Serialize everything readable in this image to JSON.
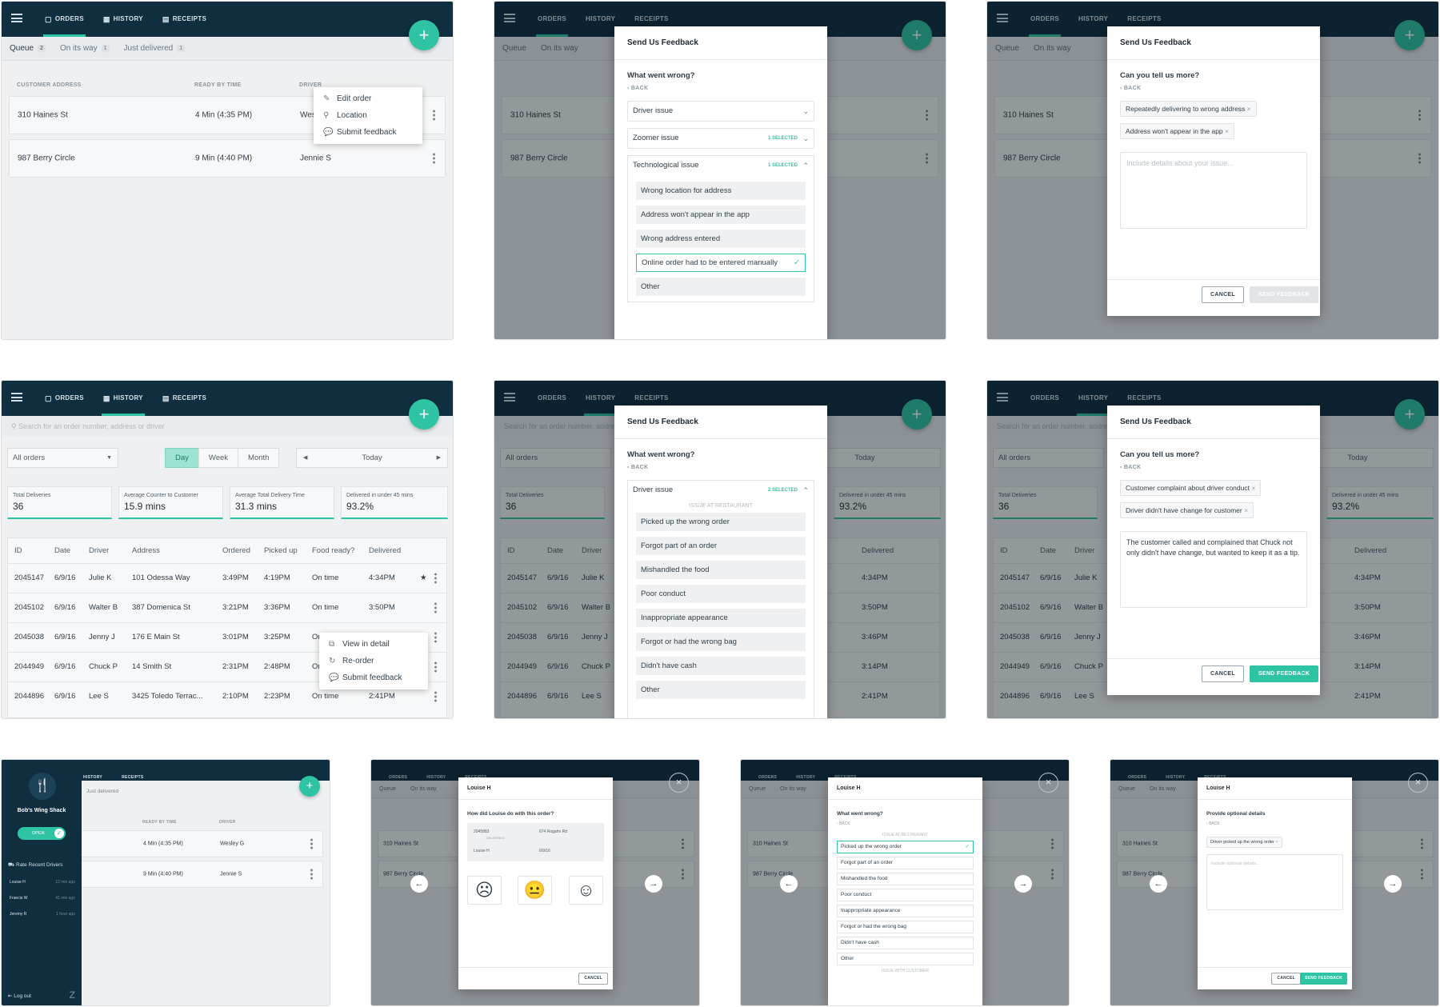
{
  "tabs": {
    "orders": "ORDERS",
    "history": "HISTORY",
    "receipts": "RECEIPTS"
  },
  "filters": {
    "queue": "Queue",
    "queue_count": "2",
    "on_way": "On its way",
    "on_way_count": "1",
    "delivered": "Just delivered",
    "delivered_count": "1"
  },
  "columns": {
    "address": "CUSTOMER ADDRESS",
    "ready": "READY BY TIME",
    "driver": "DRIVER"
  },
  "orders": [
    {
      "address": "310 Haines St",
      "ready": "4 Min (4:35 PM)",
      "driver": "Wesley G"
    },
    {
      "address": "987 Berry Circle",
      "ready": "9 Min (4:40 PM)",
      "driver": "Jennie S"
    }
  ],
  "order_menu": {
    "edit": "Edit order",
    "location": "Location",
    "feedback": "Submit feedback"
  },
  "feedback": {
    "title": "Send Us Feedback",
    "q_wrong": "What went wrong?",
    "q_more": "Can you tell us more?",
    "back": "BACK",
    "driver_issue": "Driver issue",
    "zoomer_issue": "Zoomer issue",
    "tech_issue": "Technological issue",
    "one_selected": "1 SELECTED",
    "two_selected": "2 SELECTED",
    "tech_options": [
      "Wrong location for address",
      "Address won't appear in the app",
      "Wrong address entered",
      "Online order had to be entered manually",
      "Other"
    ],
    "restaurant_header": "ISSUE AT RESTAURANT",
    "driver_options": [
      "Picked up the wrong order",
      "Forgot part of an order",
      "Mishandled the food",
      "Poor conduct",
      "Inappropriate appearance",
      "Forgot or had the wrong bag",
      "Didn't have cash",
      "Other"
    ],
    "chips_a": [
      "Repeatedly delivering to wrong address",
      "Address won't appear in the app"
    ],
    "chips_b": [
      "Customer complaint about driver conduct",
      "Driver didn't have change for customer"
    ],
    "placeholder": "Include details about your issue...",
    "details_text": "The customer called and complained that Chuck not only didn't have change, but wanted to keep it as a tip.",
    "cancel": "CANCEL",
    "send": "SEND FEEDBACK"
  },
  "history": {
    "search_placeholder": "Search for an order number, address or driver",
    "all_orders": "All orders",
    "day": "Day",
    "week": "Week",
    "month": "Month",
    "today": "Today",
    "stats": [
      {
        "label": "Total Deliveries",
        "value": "36"
      },
      {
        "label": "Average Counter to Customer",
        "value": "15.9 mins"
      },
      {
        "label": "Average Total Delivery Time",
        "value": "31.3 mins"
      },
      {
        "label": "Delivered in under 45 mins",
        "value": "93.2%"
      }
    ],
    "headers": [
      "ID",
      "Date",
      "Driver",
      "Address",
      "Ordered",
      "Picked up",
      "Food ready?",
      "Delivered"
    ],
    "rows": [
      [
        "2045147",
        "6/9/16",
        "Julie K",
        "101 Odessa Way",
        "3:49PM",
        "4:19PM",
        "On time",
        "4:34PM"
      ],
      [
        "2045102",
        "6/9/16",
        "Walter B",
        "387 Domenica St",
        "3:21PM",
        "3:36PM",
        "On time",
        "3:50PM"
      ],
      [
        "2045038",
        "6/9/16",
        "Jenny J",
        "176 E Main St",
        "3:01PM",
        "3:25PM",
        "On time",
        "3:46PM"
      ],
      [
        "2044949",
        "6/9/16",
        "Chuck P",
        "14 Smith St",
        "2:31PM",
        "2:48PM",
        "On time",
        "3:14PM"
      ],
      [
        "2044896",
        "6/9/16",
        "Lee S",
        "3425 Toledo Terrac...",
        "2:10PM",
        "2:23PM",
        "On time",
        "2:41PM"
      ]
    ],
    "row_menu": {
      "view": "View in detail",
      "reorder": "Re-order",
      "feedback": "Submit feedback"
    }
  },
  "sidebar": {
    "restaurant": "Bob's Wing Shack",
    "open": "OPEN",
    "rate": "Rate Recent Drivers",
    "drivers": [
      {
        "name": "Louise H",
        "time": "12 min ago"
      },
      {
        "name": "Francis W",
        "time": "41 min ago"
      },
      {
        "name": "Jeremy R",
        "time": "1 hour ago"
      }
    ],
    "logout": "Log out"
  },
  "rating": {
    "driver": "Louise H",
    "question": "How did Louise do with this order?",
    "order_id": "2045883",
    "delivered": "DELIVERED",
    "address": "674 Rogahn Rd",
    "date": "6/9/16",
    "optional_title": "Provide optional details",
    "optional_chip": "Driver picked up the wrong order",
    "optional_placeholder": "Include optional details...",
    "customer_header": "ISSUE WITH CUSTOMER"
  }
}
